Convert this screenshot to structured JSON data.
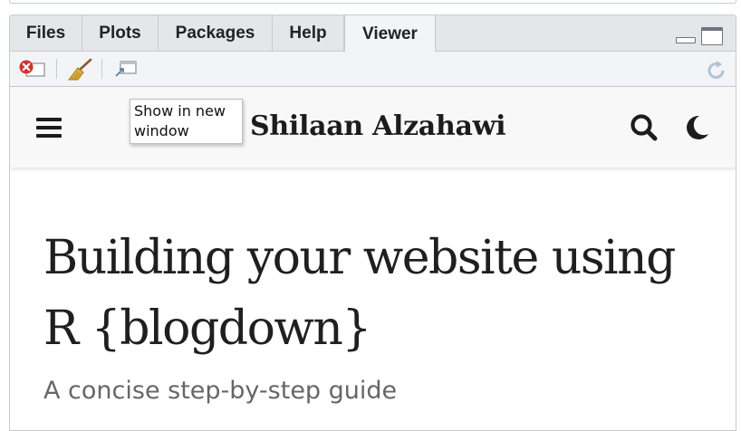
{
  "tabs": [
    {
      "label": "Files",
      "active": false
    },
    {
      "label": "Plots",
      "active": false
    },
    {
      "label": "Packages",
      "active": false
    },
    {
      "label": "Help",
      "active": false
    },
    {
      "label": "Viewer",
      "active": true
    }
  ],
  "toolbar": {
    "icons": [
      "remove-viewer-icon",
      "clear-viewer-broom-icon",
      "show-in-new-window-icon",
      "refresh-icon"
    ]
  },
  "tooltip": {
    "text": "Show in new window"
  },
  "site": {
    "title": "Shilaan Alzahawi",
    "icons": [
      "hamburger-menu-icon",
      "search-icon",
      "dark-mode-moon-icon"
    ]
  },
  "post": {
    "title": "Building your website using R {blogdown}",
    "subtitle": "A concise step-by-step guide"
  },
  "colors": {
    "tab_bar": "#e4e6e9",
    "pane_bg": "#f3f4f6",
    "site_nav_bg": "#f8f8f8",
    "text_dark": "#1f1f1f",
    "subtitle": "#666666",
    "remove_red": "#d9302c"
  }
}
